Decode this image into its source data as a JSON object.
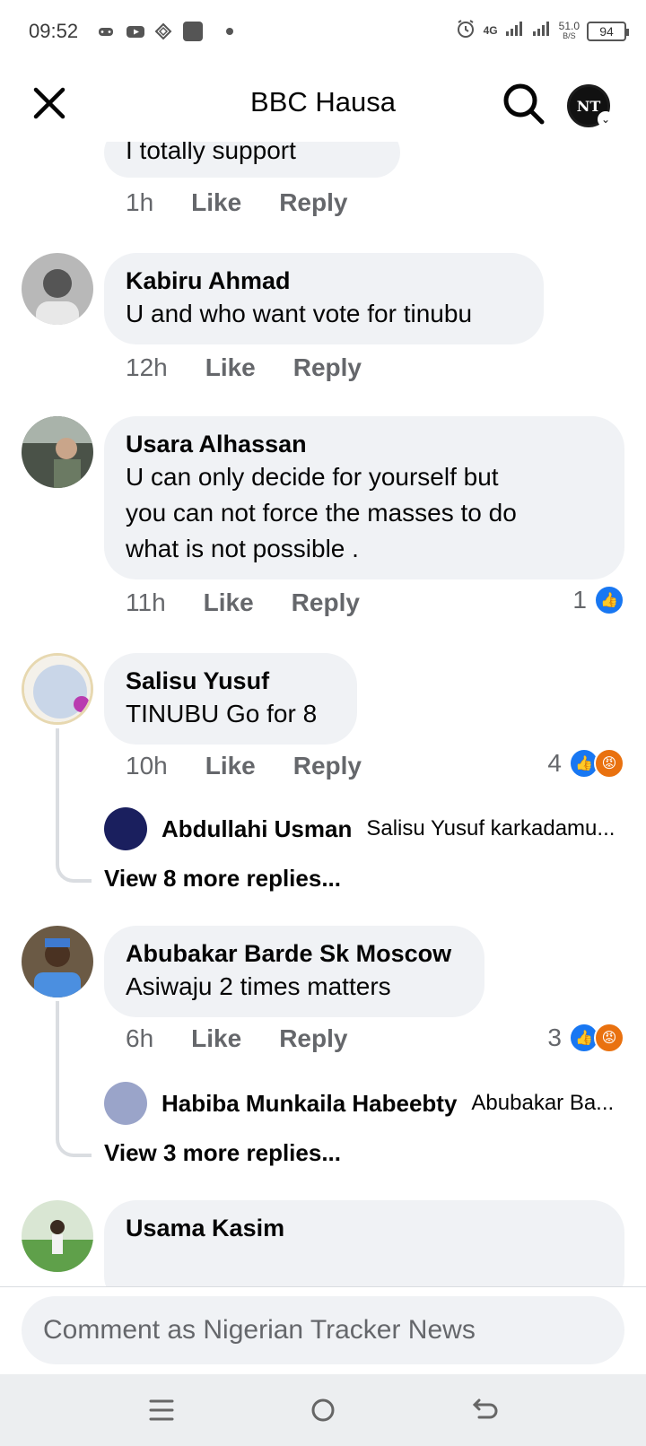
{
  "status_bar": {
    "time": "09:52",
    "network": "4G",
    "speed_value": "51.0",
    "speed_unit": "B/S",
    "battery": "94"
  },
  "header": {
    "title": "BBC Hausa",
    "profile_initials": "NT"
  },
  "comments": [
    {
      "author": "",
      "text": "I totally support",
      "time": "1h",
      "like_label": "Like",
      "reply_label": "Reply"
    },
    {
      "author": "Kabiru Ahmad",
      "text": "U and who want vote for tinubu",
      "time": "12h",
      "like_label": "Like",
      "reply_label": "Reply"
    },
    {
      "author": "Usara Alhassan",
      "text_lines": [
        "U can only decide for yourself but",
        "you can not force the masses to do",
        "what is not possible ."
      ],
      "time": "11h",
      "like_label": "Like",
      "reply_label": "Reply",
      "reaction_count": "1",
      "reactions": [
        "like-icon"
      ]
    },
    {
      "author": "Salisu Yusuf",
      "text": "TINUBU Go for 8",
      "time": "10h",
      "like_label": "Like",
      "reply_label": "Reply",
      "reaction_count": "4",
      "reactions": [
        "like-icon",
        "angry-icon"
      ],
      "reply_preview": {
        "author": "Abdullahi Usman",
        "text": "Salisu Yusuf karkadamu..."
      },
      "view_more": "View 8 more replies..."
    },
    {
      "author": "Abubakar Barde Sk Moscow",
      "text": "Asiwaju 2 times matters",
      "time": "6h",
      "like_label": "Like",
      "reply_label": "Reply",
      "reaction_count": "3",
      "reactions": [
        "like-icon",
        "angry-icon"
      ],
      "reply_preview": {
        "author": "Habiba Munkaila Habeebty",
        "text": "Abubakar Ba..."
      },
      "view_more": "View 3 more replies..."
    },
    {
      "author": "Usama Kasim"
    }
  ],
  "composer": {
    "placeholder": "Comment as Nigerian Tracker News"
  },
  "colors": {
    "bubble_bg": "#f0f2f5",
    "meta_text": "#65676b",
    "like_blue": "#1877f2",
    "angry_orange": "#e9710f"
  }
}
